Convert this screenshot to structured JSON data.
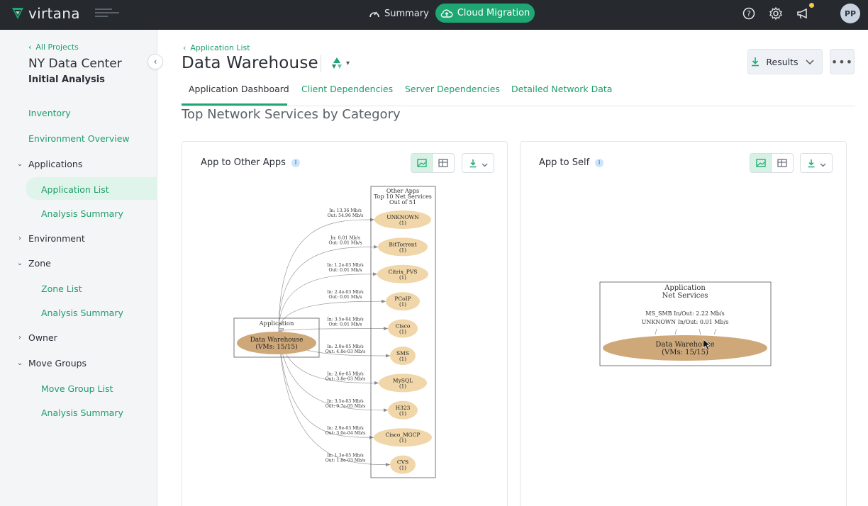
{
  "header": {
    "logo_text": "virtana",
    "nav_summary": "Summary",
    "nav_cloud": "Cloud Migration",
    "avatar_initials": "PP",
    "icons": [
      "help-icon",
      "gear-icon",
      "megaphone-icon"
    ]
  },
  "sidebar": {
    "back_link": "All Projects",
    "project_title": "NY Data Center",
    "project_subtitle": "Initial Analysis",
    "items": [
      {
        "label": "Inventory"
      },
      {
        "label": "Environment Overview"
      }
    ],
    "groups": [
      {
        "label": "Applications",
        "expanded": true,
        "children": [
          "Application List",
          "Analysis Summary"
        ]
      },
      {
        "label": "Environment",
        "expanded": false,
        "children": []
      },
      {
        "label": "Zone",
        "expanded": true,
        "children": [
          "Zone List",
          "Analysis Summary"
        ]
      },
      {
        "label": "Owner",
        "expanded": false,
        "children": []
      },
      {
        "label": "Move Groups",
        "expanded": true,
        "children": [
          "Move Group List",
          "Analysis Summary"
        ]
      }
    ],
    "active_item": "Application List"
  },
  "main": {
    "breadcrumb": "Application List",
    "title": "Data Warehouse",
    "results_label": "Results",
    "more_label": "•••",
    "tabs": [
      {
        "label": "Application Dashboard",
        "active": true
      },
      {
        "label": "Client Dependencies",
        "active": false
      },
      {
        "label": "Server Dependencies",
        "active": false
      },
      {
        "label": "Detailed Network Data",
        "active": false
      }
    ],
    "section_title": "Top Network Services by Category",
    "accent_color": "#1ea772"
  },
  "panels": {
    "other_apps": {
      "title": "App to Other Apps",
      "graph": {
        "app_box_label": "Application",
        "app_box_marker": "IP",
        "app_node": [
          "Data Warehouse",
          "(VMs: 15/15)"
        ],
        "services_header": [
          "Other Apps",
          "Top 10 Net Services",
          "Out of 51"
        ],
        "services": [
          {
            "name": "UNKNOWN",
            "count": "(1)",
            "in": "In: 13.36 Mb/s",
            "out": "Out: 54.96 Mb/s"
          },
          {
            "name": "BitTorrent",
            "count": "(1)",
            "in": "In: 0.01 Mb/s",
            "out": "Out: 0.01 Mb/s"
          },
          {
            "name": "Citrix_PVS",
            "count": "(1)",
            "in": "In: 1.2e-03  Mb/s",
            "out": "Out: 0.01 Mb/s"
          },
          {
            "name": "PCoIP",
            "count": "(1)",
            "in": "In: 2.4e-03  Mb/s",
            "out": "Out: 0.01 Mb/s"
          },
          {
            "name": "Cisco",
            "count": "(1)",
            "in": "In: 3.5e-04  Mb/s",
            "out": "Out: 0.01 Mb/s"
          },
          {
            "name": "SMS",
            "count": "(1)",
            "in": "In: 2.0e-05  Mb/s",
            "out": "Out: 4.8e-03  Mb/s"
          },
          {
            "name": "MySQL",
            "count": "(1)",
            "in": "In: 2.6e-05  Mb/s",
            "out": "Out: 3.8e-03  Mb/s"
          },
          {
            "name": "H323",
            "count": "(1)",
            "in": "In: 3.5e-03  Mb/s",
            "out": "Out: 9.7e-05  Mb/s"
          },
          {
            "name": "Cisco_MGCP",
            "count": "(1)",
            "in": "In: 2.9e-03  Mb/s",
            "out": "Out: 3.0e-04  Mb/s"
          },
          {
            "name": "CVS",
            "count": "(1)",
            "in": "In: 1.3e-05  Mb/s",
            "out": "Out: 1.8e-03  Mb/s"
          }
        ]
      }
    },
    "self": {
      "title": "App to Self",
      "graph": {
        "header": [
          "Application",
          "Net Services"
        ],
        "lines": [
          "MS_SMB  In/Out: 2.22 Mb/s",
          "UNKNOWN  In/Out: 0.01 Mb/s"
        ],
        "node": [
          "Data Warehouse",
          "(VMs: 15/15)"
        ]
      }
    }
  }
}
